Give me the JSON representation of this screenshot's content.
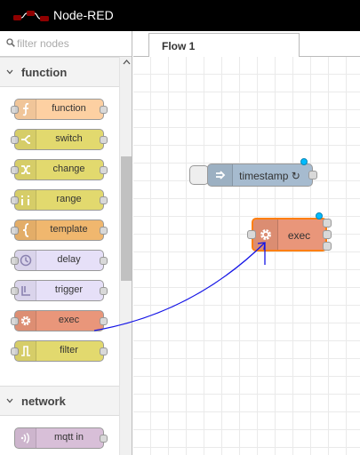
{
  "app": {
    "title": "Node-RED"
  },
  "palette": {
    "filter_placeholder": "filter nodes",
    "categories": [
      {
        "label": "function",
        "nodes": [
          {
            "label": "function",
            "color": "#fdd0a2",
            "icon": "function-icon"
          },
          {
            "label": "switch",
            "color": "#e2d96e",
            "icon": "switch-icon"
          },
          {
            "label": "change",
            "color": "#e2d96e",
            "icon": "change-icon"
          },
          {
            "label": "range",
            "color": "#e2d96e",
            "icon": "range-icon"
          },
          {
            "label": "template",
            "color": "#f0b76e",
            "icon": "template-icon"
          },
          {
            "label": "delay",
            "color": "#e6e0f8",
            "icon": "delay-icon"
          },
          {
            "label": "trigger",
            "color": "#e6e0f8",
            "icon": "trigger-icon"
          },
          {
            "label": "exec",
            "color": "#e9967a",
            "icon": "exec-icon"
          },
          {
            "label": "filter",
            "color": "#e2d96e",
            "icon": "filter-icon"
          }
        ]
      },
      {
        "label": "network",
        "nodes": [
          {
            "label": "mqtt in",
            "color": "#d8bfd8",
            "icon": "mqtt-icon"
          }
        ]
      }
    ]
  },
  "workspace": {
    "tabs": [
      {
        "label": "Flow 1"
      }
    ],
    "nodes": {
      "timestamp": {
        "label": "timestamp ↻",
        "color": "#a6bbcf",
        "icon": "inject-icon"
      },
      "exec": {
        "label": "exec",
        "color": "#e9967a",
        "icon": "exec-icon"
      }
    }
  },
  "colors": {
    "header": "#000000",
    "selection": "#ff7f0e",
    "changed_dot": "#00bcff",
    "wire_drag": "#0000ff"
  }
}
